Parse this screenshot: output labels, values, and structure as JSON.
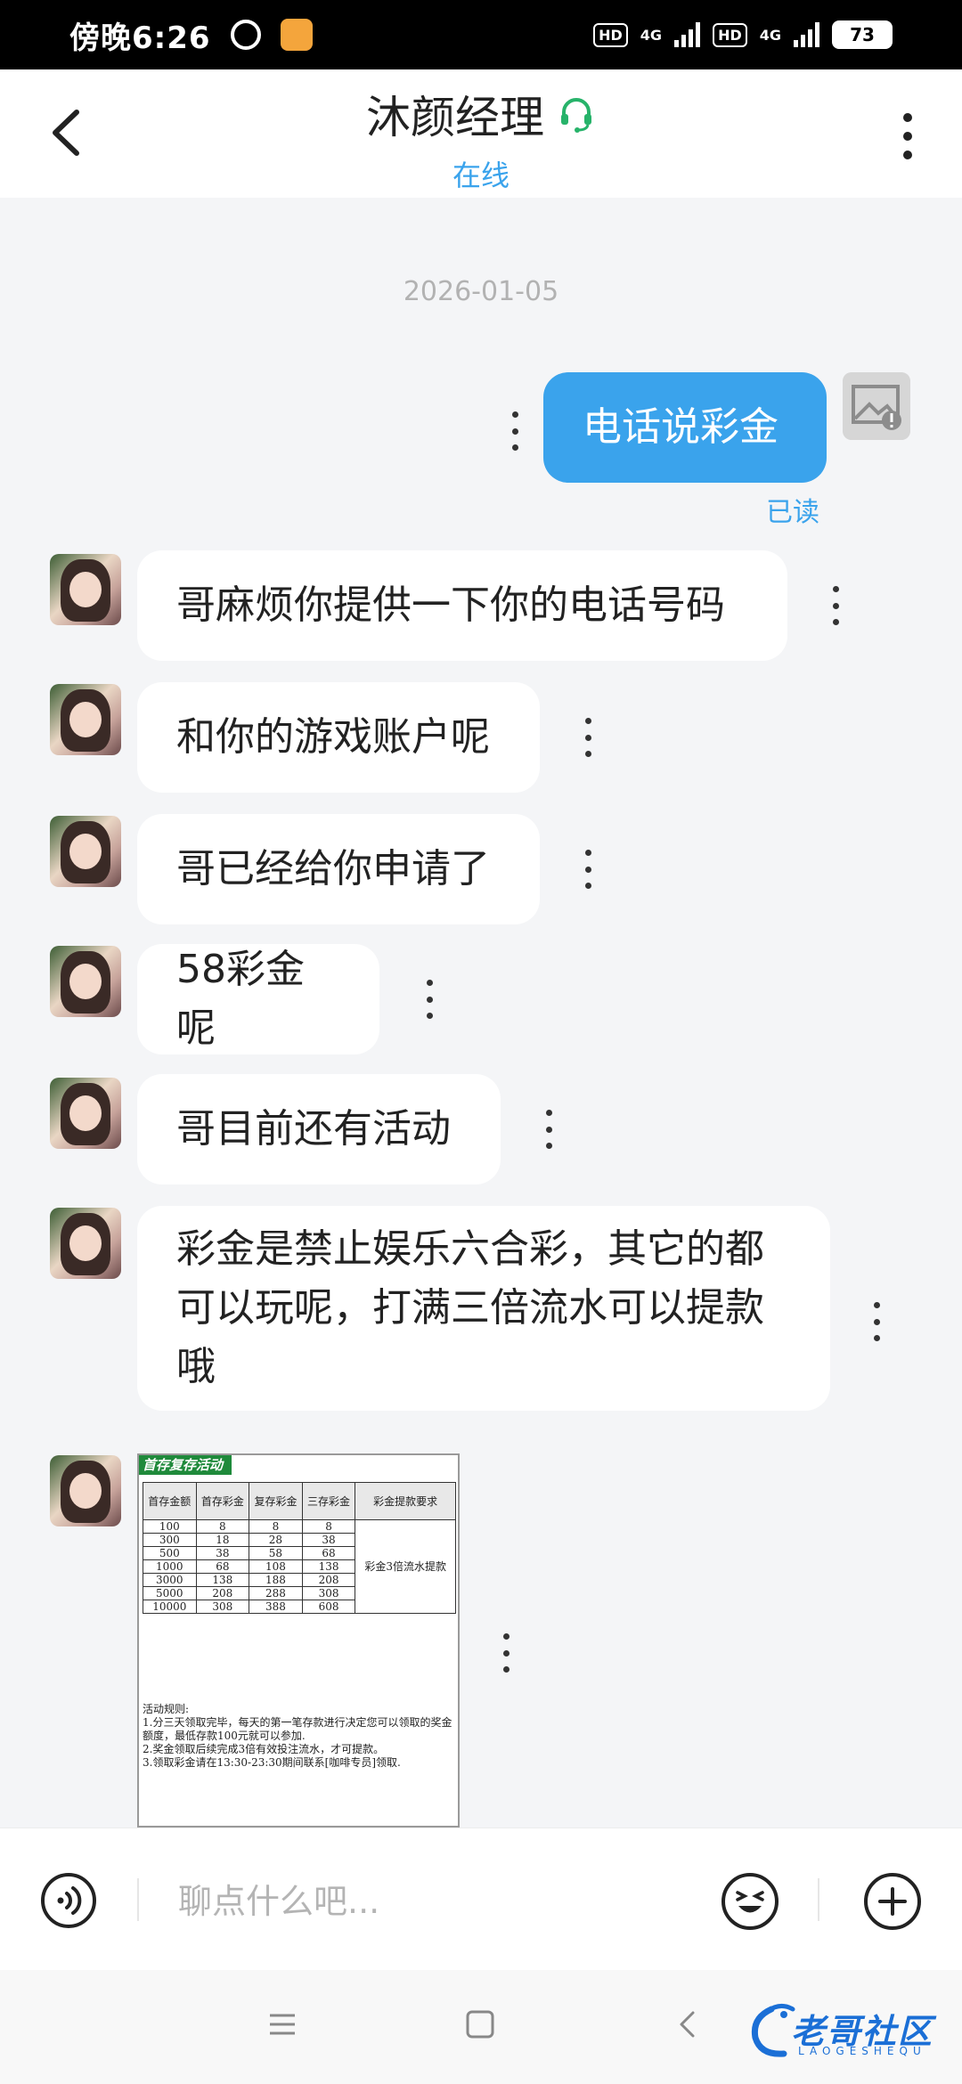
{
  "status_bar": {
    "time": "傍晚6:26",
    "hd1": "HD",
    "net1": "4G",
    "hd2": "HD",
    "net2": "4G",
    "battery": "73"
  },
  "header": {
    "title": "沐颜经理",
    "status": "在线",
    "icons": [
      "back-arrow-icon",
      "headset-icon",
      "more-vertical-icon"
    ]
  },
  "chat": {
    "date": "2026-01-05",
    "outgoing": {
      "text": "电话说彩金",
      "read_status": "已读"
    },
    "incoming": [
      {
        "text": "哥麻烦你提供一下你的电话号码"
      },
      {
        "text": "和你的游戏账户呢"
      },
      {
        "text": "哥已经给你申请了"
      },
      {
        "text": "58彩金呢"
      },
      {
        "text": "哥目前还有活动"
      },
      {
        "lines": [
          "彩金是禁止娱乐六合彩，其它的都",
          "可以玩呢，打满三倍流水可以提款",
          "哦"
        ]
      }
    ],
    "promo_image": {
      "ribbon": "首存复存活动",
      "headers": [
        "首存金额",
        "首存彩金",
        "复存彩金",
        "三存彩金",
        "彩金提款要求"
      ],
      "rows": [
        [
          "100",
          "8",
          "8",
          "8"
        ],
        [
          "300",
          "18",
          "28",
          "38"
        ],
        [
          "500",
          "38",
          "58",
          "68"
        ],
        [
          "1000",
          "68",
          "108",
          "138"
        ],
        [
          "3000",
          "138",
          "188",
          "208"
        ],
        [
          "5000",
          "208",
          "288",
          "308"
        ],
        [
          "10000",
          "308",
          "388",
          "608"
        ]
      ],
      "requirement": "彩金3倍流水提款",
      "rules_title": "活动规则:",
      "rules": [
        "1.分三天领取完毕，每天的第一笔存款进行决定您可以领取的奖金额度，最低存款100元就可以参加.",
        "2.奖金领取后续完成3倍有效投注流水，才可提款。",
        "3.领取彩金请在13:30-23:30期间联系[咖啡专员]领取."
      ]
    }
  },
  "input_bar": {
    "placeholder": "聊点什么吧...",
    "icons": [
      "voice-icon",
      "emoji-icon",
      "plus-icon"
    ]
  },
  "nav_bar": {
    "watermark_text": "老哥社区",
    "watermark_sub": "LAOGESHEQU"
  },
  "colors": {
    "accent": "#3aa3ec",
    "headset": "#27b36a",
    "page_bg": "#f4f5f7"
  }
}
